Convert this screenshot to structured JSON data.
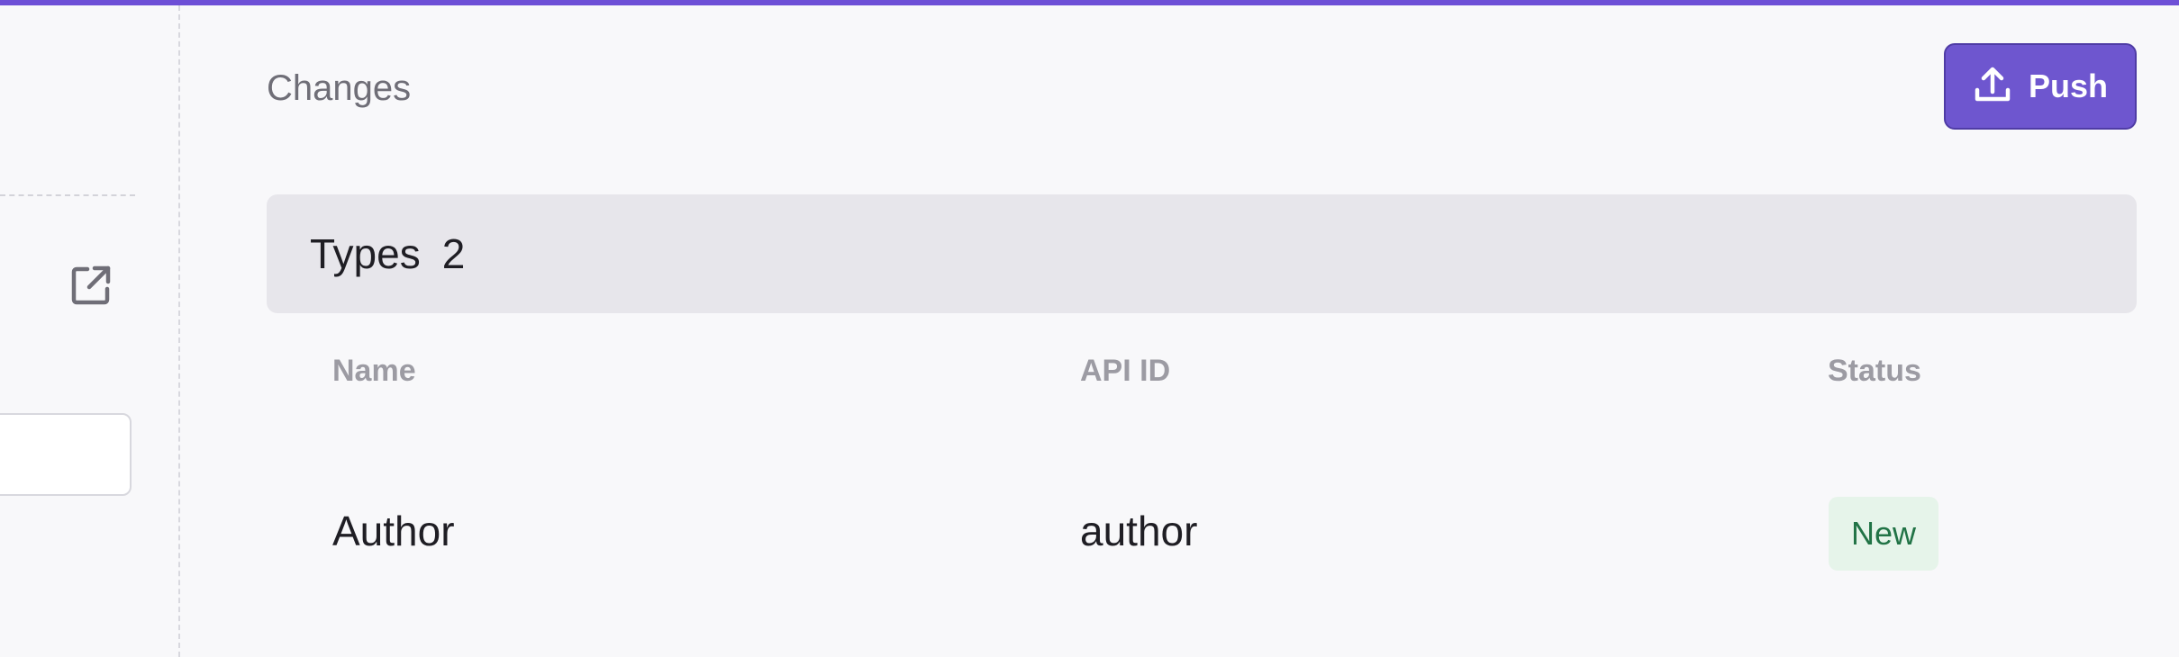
{
  "header": {
    "title": "Changes",
    "push_label": "Push",
    "accent_color": "#6e56cf"
  },
  "sidebar": {
    "open_icon": "open-external-icon"
  },
  "types_section": {
    "label": "Types",
    "count": "2",
    "columns": [
      "Name",
      "API ID",
      "Status"
    ],
    "rows": [
      {
        "name": "Author",
        "api_id": "author",
        "status": "New"
      }
    ]
  }
}
